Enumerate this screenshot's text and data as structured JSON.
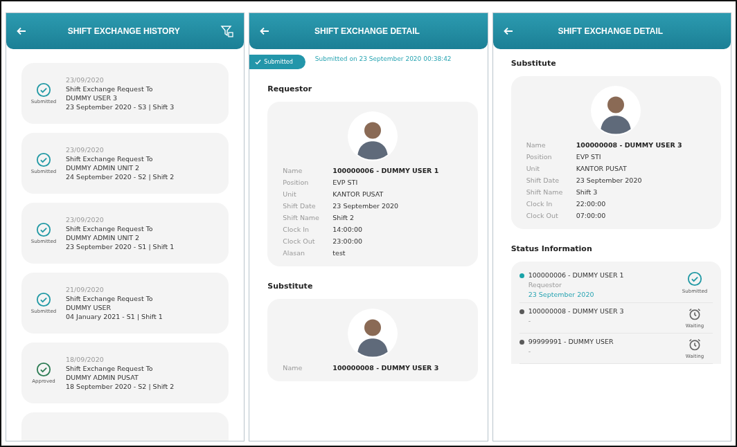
{
  "history_screen": {
    "title": "SHIFT EXCHANGE HISTORY",
    "items": [
      {
        "date": "23/09/2020",
        "title": "Shift Exchange Request To",
        "recipient": "DUMMY USER 3",
        "shift": "23 September 2020 - S3 | Shift 3",
        "status": "Submitted",
        "kind": "submitted"
      },
      {
        "date": "23/09/2020",
        "title": "Shift Exchange Request To",
        "recipient": "DUMMY ADMIN UNIT 2",
        "shift": "24 September 2020 - S2 | Shift 2",
        "status": "Submitted",
        "kind": "submitted"
      },
      {
        "date": "23/09/2020",
        "title": "Shift Exchange Request To",
        "recipient": "DUMMY ADMIN UNIT 2",
        "shift": "23 September 2020 - S1 | Shift 1",
        "status": "Submitted",
        "kind": "submitted"
      },
      {
        "date": "21/09/2020",
        "title": "Shift Exchange Request To",
        "recipient": "DUMMY USER",
        "shift": "04 January 2021 - S1 | Shift 1",
        "status": "Submitted",
        "kind": "submitted"
      },
      {
        "date": "18/09/2020",
        "title": "Shift Exchange Request To",
        "recipient": "DUMMY ADMIN PUSAT",
        "shift": "18 September 2020 - S2 | Shift 2",
        "status": "Approved",
        "kind": "approved"
      }
    ]
  },
  "detail_screen": {
    "title": "SHIFT EXCHANGE DETAIL",
    "status_badge": "Submitted",
    "submitted_text": "Submitted on 23 September 2020 00:38:42",
    "sections": [
      {
        "heading": "Requestor",
        "fields": [
          {
            "label": "Name",
            "value": "100000006 - DUMMY USER 1"
          },
          {
            "label": "Position",
            "value": "EVP STI"
          },
          {
            "label": "Unit",
            "value": "KANTOR PUSAT"
          },
          {
            "label": "Shift Date",
            "value": "23 September 2020"
          },
          {
            "label": "Shift Name",
            "value": "Shift 2"
          },
          {
            "label": "Clock In",
            "value": "14:00:00"
          },
          {
            "label": "Clock Out",
            "value": "23:00:00"
          },
          {
            "label": "Alasan",
            "value": "test"
          }
        ]
      },
      {
        "heading": "Substitute",
        "fields": [
          {
            "label": "Name",
            "value": "100000008 - DUMMY USER 3"
          }
        ]
      }
    ]
  },
  "detail_screen_2": {
    "title": "SHIFT EXCHANGE DETAIL",
    "sections": [
      {
        "heading": "Substitute",
        "fields": [
          {
            "label": "Name",
            "value": "100000008 - DUMMY USER 3"
          },
          {
            "label": "Position",
            "value": "EVP STI"
          },
          {
            "label": "Unit",
            "value": "KANTOR PUSAT"
          },
          {
            "label": "Shift Date",
            "value": "23 September 2020"
          },
          {
            "label": "Shift Name",
            "value": "Shift 3"
          },
          {
            "label": "Clock In",
            "value": "22:00:00"
          },
          {
            "label": "Clock Out",
            "value": "07:00:00"
          }
        ]
      }
    ],
    "status_heading": "Status Information",
    "status_items": [
      {
        "name": "100000006 - DUMMY USER 1",
        "role": "Requestor",
        "date": "23 September 2020",
        "status": "Submitted",
        "kind": "submitted",
        "color": "#1aa3a8"
      },
      {
        "name": "100000008 - DUMMY USER 3",
        "date": "-",
        "status": "Waiting",
        "kind": "waiting",
        "color": "#5a5a5a"
      },
      {
        "name": "99999991 - DUMMY USER",
        "date": "-",
        "status": "Waiting",
        "kind": "waiting",
        "color": "#5a5a5a"
      }
    ]
  }
}
